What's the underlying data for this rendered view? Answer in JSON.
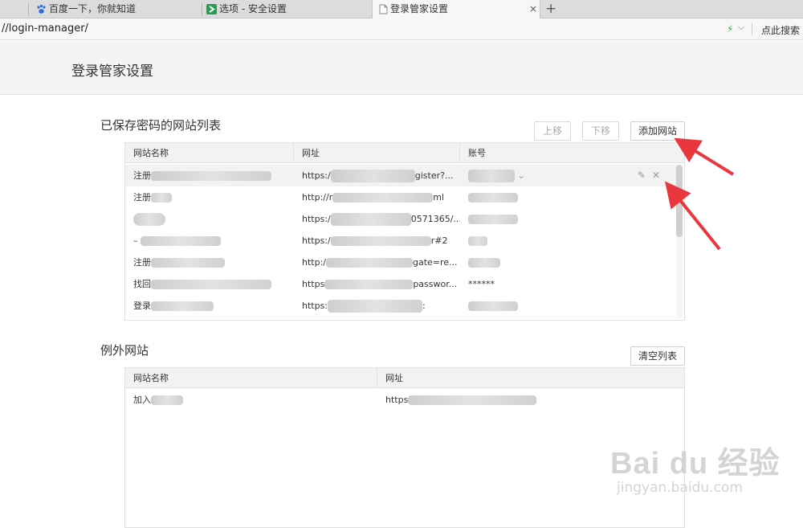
{
  "tabs": [
    {
      "label": "百度一下，你就知道",
      "icon": "paw-icon"
    },
    {
      "label": "选项 - 安全设置",
      "icon": "shield-icon"
    },
    {
      "label": "登录管家设置",
      "icon": "page-icon",
      "active": true
    }
  ],
  "tab_close": "×",
  "tab_new": "+",
  "address": {
    "url": "//login-manager/",
    "search_label": "点此搜索",
    "bolt_icon": "bolt-icon"
  },
  "page_title": "登录管家设置",
  "saved": {
    "title": "已保存密码的网站列表",
    "btn_up": "上移",
    "btn_down": "下移",
    "btn_add": "添加网站",
    "columns": [
      "网站名称",
      "网址",
      "账号"
    ],
    "rows": [
      {
        "name": "注册",
        "url_pre": "https:/",
        "url_post": "gister?...",
        "account": "",
        "highlight": true
      },
      {
        "name": "注册",
        "url_pre": "http://r",
        "url_post": "ml",
        "account": ""
      },
      {
        "name": "",
        "url_pre": "https:/",
        "url_post": "0571365/...",
        "account": ""
      },
      {
        "name": "–",
        "url_pre": "https:/",
        "url_post": "r#2",
        "account": ""
      },
      {
        "name": "注册",
        "url_pre": "http:/",
        "url_post": "gate=re...",
        "account": ""
      },
      {
        "name": "找回",
        "url_pre": "https",
        "url_post": "passwor...",
        "account": "******"
      },
      {
        "name": "登录",
        "url_pre": "https:",
        "url_post": ":",
        "account": ""
      }
    ]
  },
  "exceptions": {
    "title": "例外网站",
    "btn_clear": "清空列表",
    "columns": [
      "网站名称",
      "网址"
    ],
    "rows": [
      {
        "name": "加入",
        "url_pre": "https"
      }
    ]
  },
  "watermark": {
    "logo": "Bai du 经验",
    "url": "jingyan.baidu.com"
  },
  "colors": {
    "arrow": "#e8383d",
    "bolt": "#2aa845"
  }
}
